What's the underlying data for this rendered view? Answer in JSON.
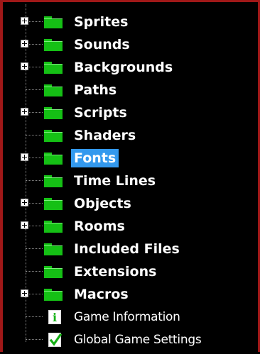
{
  "tree": {
    "items": [
      {
        "label": "Sprites",
        "expandable": true,
        "icon": "folder-icon"
      },
      {
        "label": "Sounds",
        "expandable": true,
        "icon": "folder-icon"
      },
      {
        "label": "Backgrounds",
        "expandable": true,
        "icon": "folder-icon"
      },
      {
        "label": "Paths",
        "expandable": false,
        "icon": "folder-icon"
      },
      {
        "label": "Scripts",
        "expandable": true,
        "icon": "folder-icon"
      },
      {
        "label": "Shaders",
        "expandable": false,
        "icon": "folder-icon"
      },
      {
        "label": "Fonts",
        "expandable": true,
        "icon": "folder-icon",
        "selected": true
      },
      {
        "label": "Time Lines",
        "expandable": false,
        "icon": "folder-icon"
      },
      {
        "label": "Objects",
        "expandable": true,
        "icon": "folder-icon"
      },
      {
        "label": "Rooms",
        "expandable": true,
        "icon": "folder-icon"
      },
      {
        "label": "Included Files",
        "expandable": false,
        "icon": "folder-icon"
      },
      {
        "label": "Extensions",
        "expandable": false,
        "icon": "folder-icon"
      },
      {
        "label": "Macros",
        "expandable": true,
        "icon": "folder-icon"
      },
      {
        "label": "Game Information",
        "expandable": false,
        "icon": "info-icon"
      },
      {
        "label": "Global Game Settings",
        "expandable": false,
        "icon": "checkmark-icon"
      }
    ],
    "info_icon_glyph": "i"
  },
  "colors": {
    "background": "#000000",
    "folder_green": "#15c015",
    "selection_blue": "#3399ee",
    "window_border": "#a01818"
  }
}
